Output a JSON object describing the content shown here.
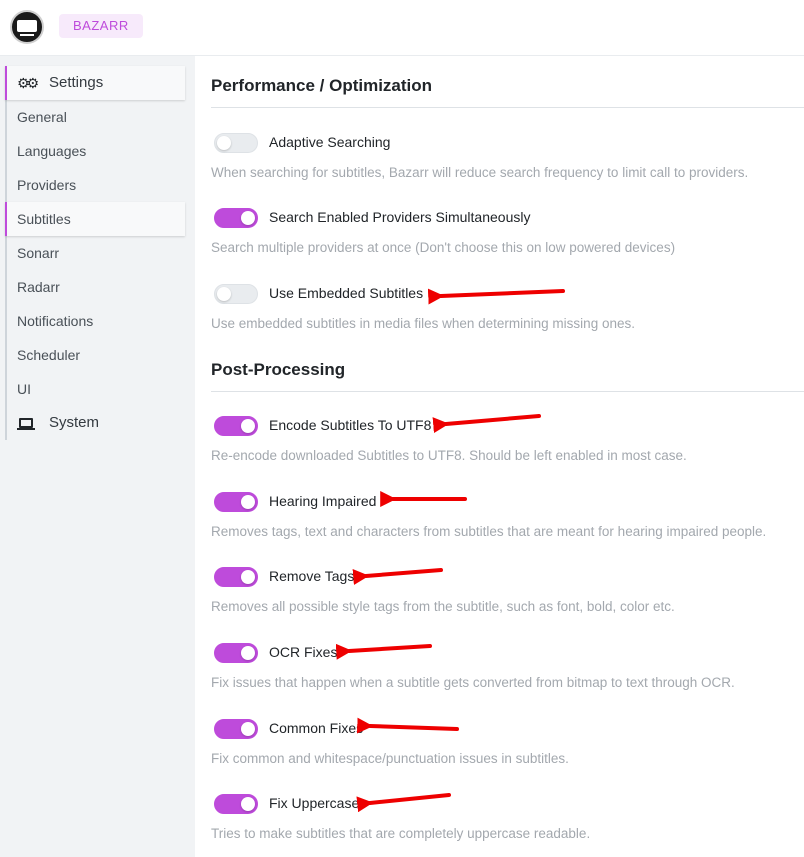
{
  "app": {
    "brand": "BAZARR"
  },
  "colors": {
    "accent": "#be4bdb",
    "arrow": "#ee0000"
  },
  "sidebar": {
    "items": [
      {
        "label": "Settings",
        "icon": "gears-icon",
        "group": true
      },
      {
        "label": "General"
      },
      {
        "label": "Languages"
      },
      {
        "label": "Providers"
      },
      {
        "label": "Subtitles",
        "active": true
      },
      {
        "label": "Sonarr"
      },
      {
        "label": "Radarr"
      },
      {
        "label": "Notifications"
      },
      {
        "label": "Scheduler"
      },
      {
        "label": "UI"
      },
      {
        "label": "System",
        "icon": "laptop-icon",
        "group": true
      }
    ]
  },
  "sections": [
    {
      "title": "Performance / Optimization",
      "settings": [
        {
          "label": "Adaptive Searching",
          "enabled": false,
          "description": "When searching for subtitles, Bazarr will reduce search frequency to limit call to providers."
        },
        {
          "label": "Search Enabled Providers Simultaneously",
          "enabled": true,
          "description": "Search multiple providers at once (Don't choose this on low powered devices)"
        },
        {
          "label": "Use Embedded Subtitles",
          "enabled": false,
          "description": "Use embedded subtitles in media files when determining missing ones."
        }
      ]
    },
    {
      "title": "Post-Processing",
      "settings": [
        {
          "label": "Encode Subtitles To UTF8",
          "enabled": true,
          "description": "Re-encode downloaded Subtitles to UTF8. Should be left enabled in most case."
        },
        {
          "label": "Hearing Impaired",
          "enabled": true,
          "description": "Removes tags, text and characters from subtitles that are meant for hearing impaired people."
        },
        {
          "label": "Remove Tags",
          "enabled": true,
          "description": "Removes all possible style tags from the subtitle, such as font, bold, color etc."
        },
        {
          "label": "OCR Fixes",
          "enabled": true,
          "description": "Fix issues that happen when a subtitle gets converted from bitmap to text through OCR."
        },
        {
          "label": "Common Fixes",
          "enabled": true,
          "description": "Fix common and whitespace/punctuation issues in subtitles."
        },
        {
          "label": "Fix Uppercase",
          "enabled": true,
          "description": "Tries to make subtitles that are completely uppercase readable."
        }
      ]
    }
  ]
}
